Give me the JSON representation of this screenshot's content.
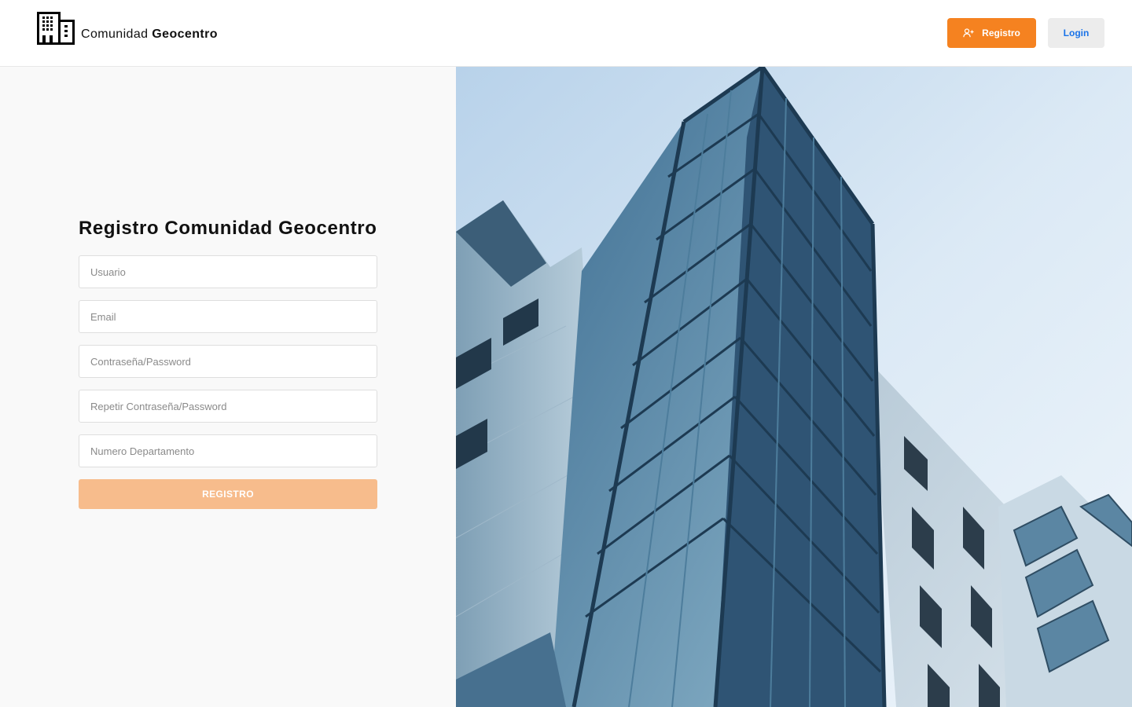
{
  "header": {
    "brand_prefix": "Comunidad",
    "brand_name": "Geocentro",
    "register_label": "Registro",
    "login_label": "Login"
  },
  "form": {
    "title": "Registro Comunidad Geocentro",
    "fields": {
      "usuario": "Usuario",
      "email": "Email",
      "password": "Contraseña/Password",
      "repeat_password": "Repetir Contraseña/Password",
      "department": "Numero Departamento"
    },
    "submit_label": "REGISTRO"
  },
  "colors": {
    "accent": "#f58220",
    "accent_disabled": "#f7bc8c",
    "login_text": "#1a73e8"
  },
  "icons": [
    "building-icon",
    "user-plus-icon"
  ]
}
